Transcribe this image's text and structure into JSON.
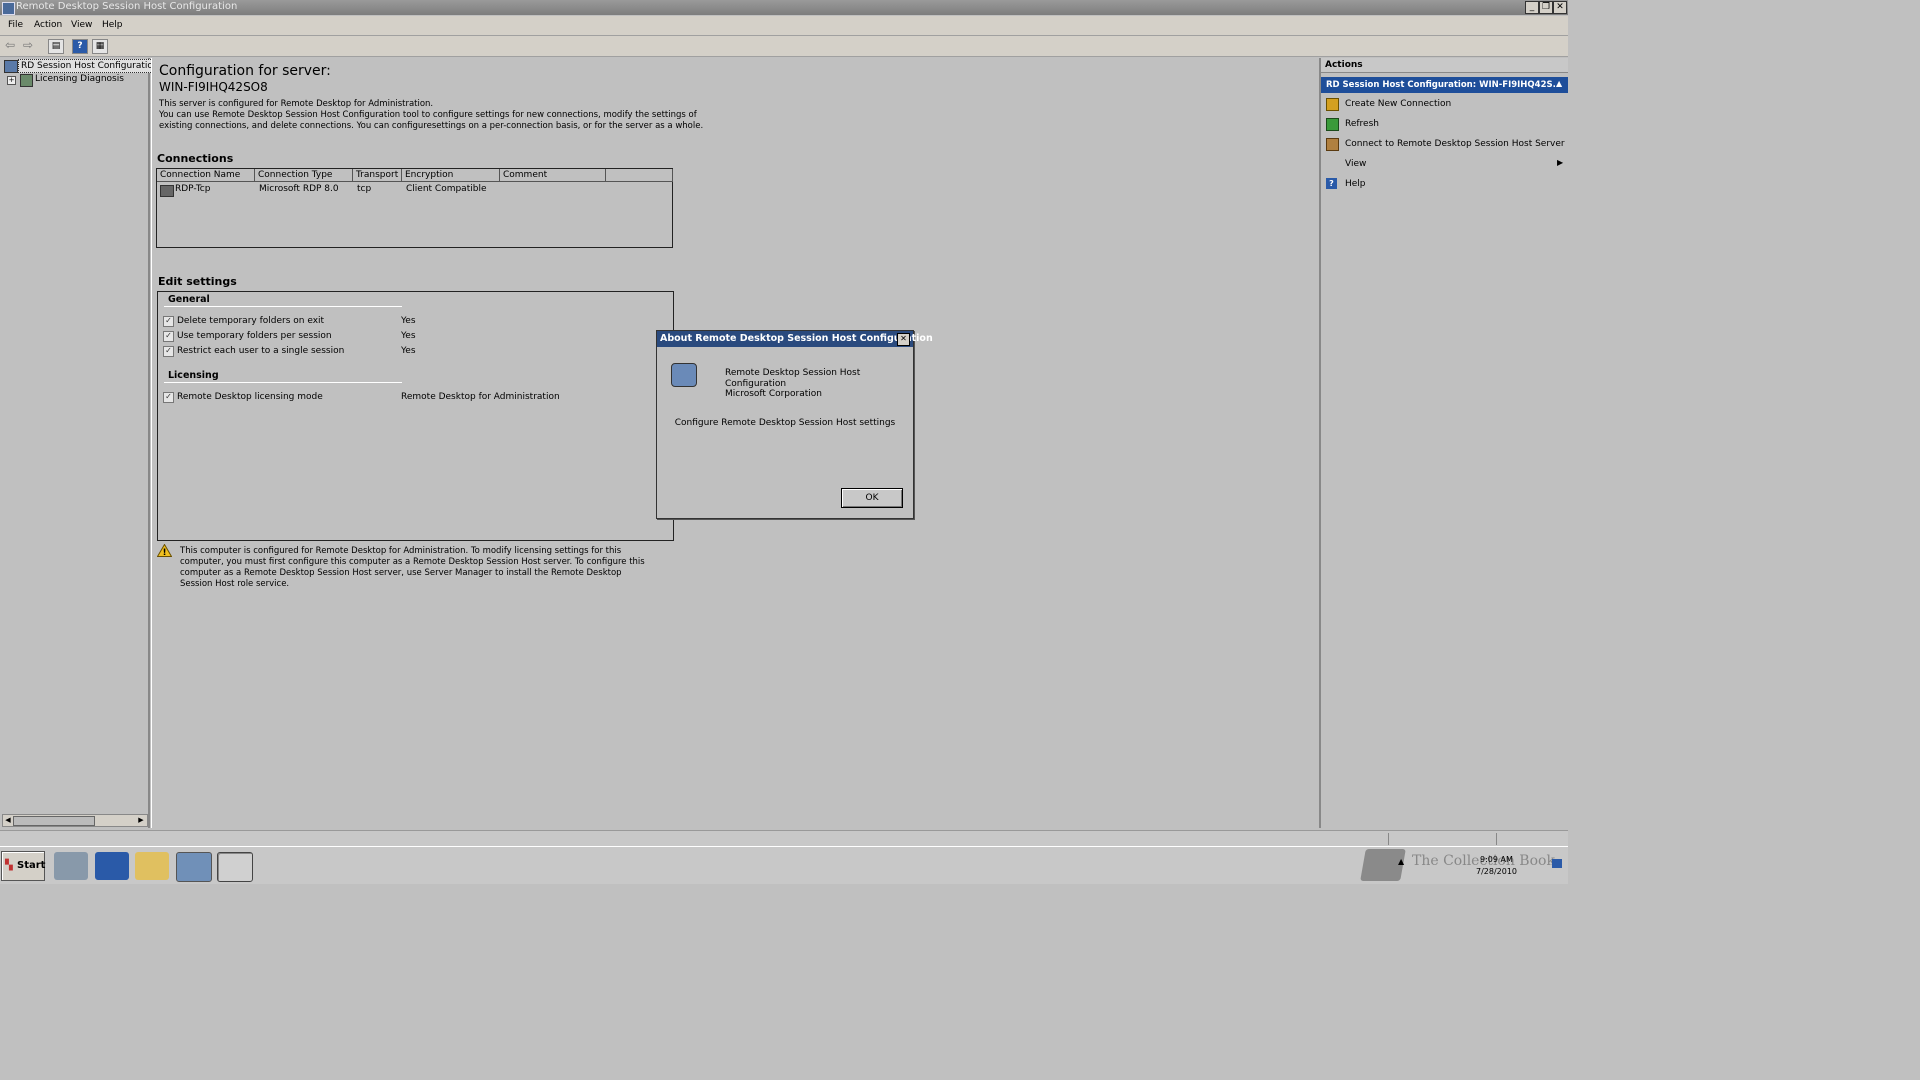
{
  "window": {
    "title": "Remote Desktop Session Host Configuration"
  },
  "menu": [
    "File",
    "Action",
    "View",
    "Help"
  ],
  "tree": {
    "root": "RD Session Host Configuration:",
    "child": "Licensing Diagnosis"
  },
  "center": {
    "heading": "Configuration for server:",
    "server": "WIN-FI9IHQ42SO8",
    "desc1": "This server is configured for Remote Desktop for Administration.",
    "desc2": "You can use Remote Desktop Session Host Configuration tool to configure settings for new connections, modify the settings of",
    "desc3": "existing connections, and delete connections. You can configuresettings on a per-connection basis, or for the server as a whole.",
    "connections_title": "Connections",
    "columns": [
      "Connection Name",
      "Connection Type",
      "Transport",
      "Encryption",
      "Comment"
    ],
    "rows": [
      {
        "name": "RDP-Tcp",
        "type": "Microsoft RDP 8.0",
        "transport": "tcp",
        "encryption": "Client Compatible",
        "comment": ""
      }
    ],
    "edit_title": "Edit settings",
    "general_title": "General",
    "general": [
      {
        "label": "Delete temporary folders on exit",
        "value": "Yes"
      },
      {
        "label": "Use temporary folders per session",
        "value": "Yes"
      },
      {
        "label": "Restrict each user to a single session",
        "value": "Yes"
      }
    ],
    "licensing_title": "Licensing",
    "licensing": [
      {
        "label": "Remote Desktop licensing mode",
        "value": "Remote Desktop for Administration"
      }
    ],
    "warning1": "This computer is configured for Remote Desktop for Administration. To modify licensing settings for this",
    "warning2": "computer, you must first configure this computer as a Remote Desktop Session Host server. To configure this",
    "warning3": "computer as a Remote Desktop Session Host server, use Server Manager to install the Remote Desktop",
    "warning4": "Session Host role service."
  },
  "actions": {
    "title": "Actions",
    "section": "RD Session Host Configuration: WIN-FI9IHQ42S...",
    "items": [
      "Create New Connection",
      "Refresh",
      "Connect to Remote Desktop Session Host Server",
      "View",
      "Help"
    ]
  },
  "dialog": {
    "title": "About Remote Desktop Session Host Configuration",
    "line1": "Remote Desktop Session Host",
    "line2": "Configuration",
    "line3": "Microsoft Corporation",
    "desc": "Configure Remote Desktop Session Host settings",
    "ok": "OK"
  },
  "taskbar": {
    "start": "Start",
    "time": "9:09 AM",
    "date": "7/28/2010"
  },
  "watermark": "The Collection Book",
  "colors": {
    "accent": "#2a4a7e",
    "window": "#c0c0c0"
  }
}
